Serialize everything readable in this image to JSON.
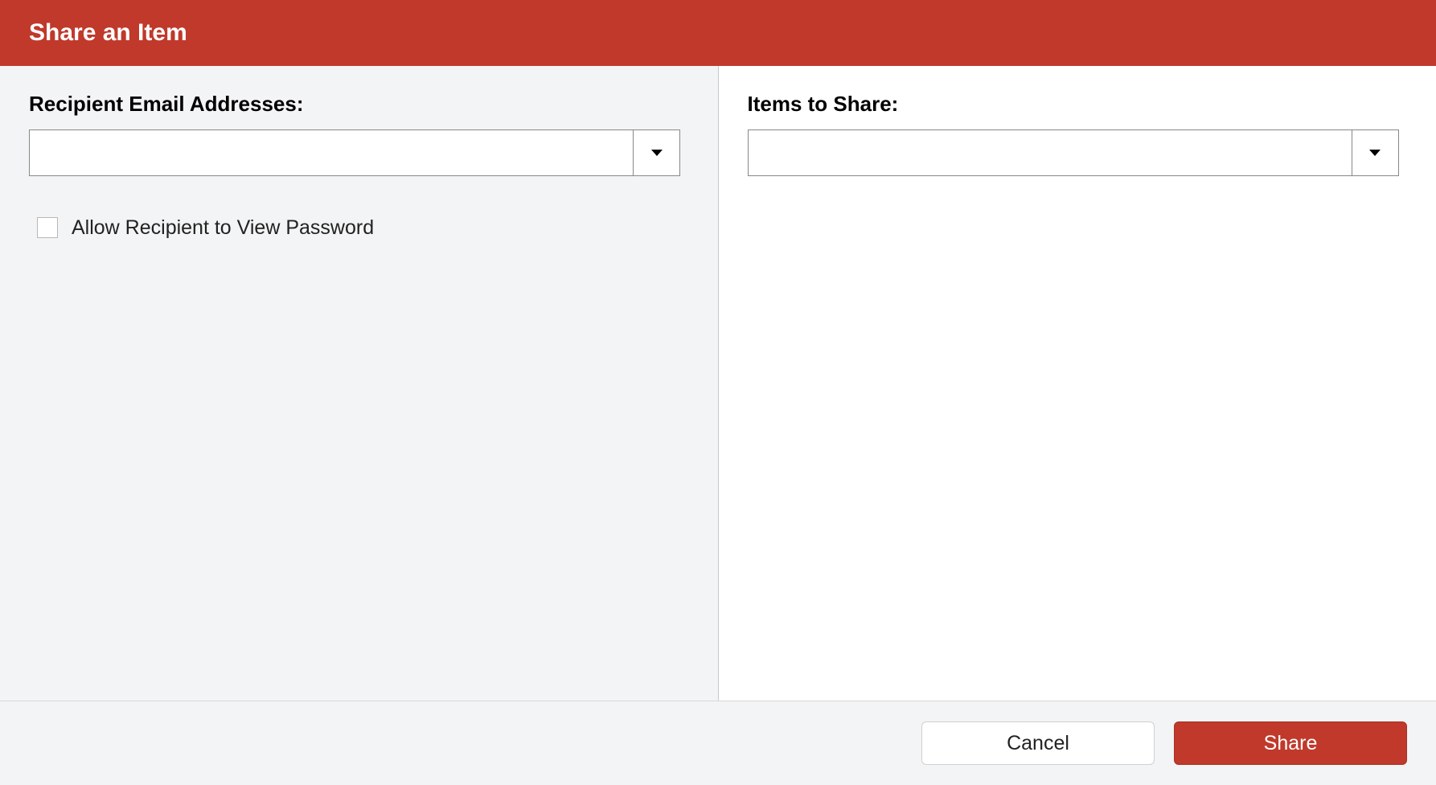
{
  "dialog": {
    "title": "Share an Item"
  },
  "left": {
    "recipients_label": "Recipient Email Addresses:",
    "recipients_value": "",
    "allow_view_password_label": "Allow Recipient to View Password"
  },
  "right": {
    "items_label": "Items to Share:",
    "items_value": ""
  },
  "footer": {
    "cancel_label": "Cancel",
    "share_label": "Share"
  }
}
